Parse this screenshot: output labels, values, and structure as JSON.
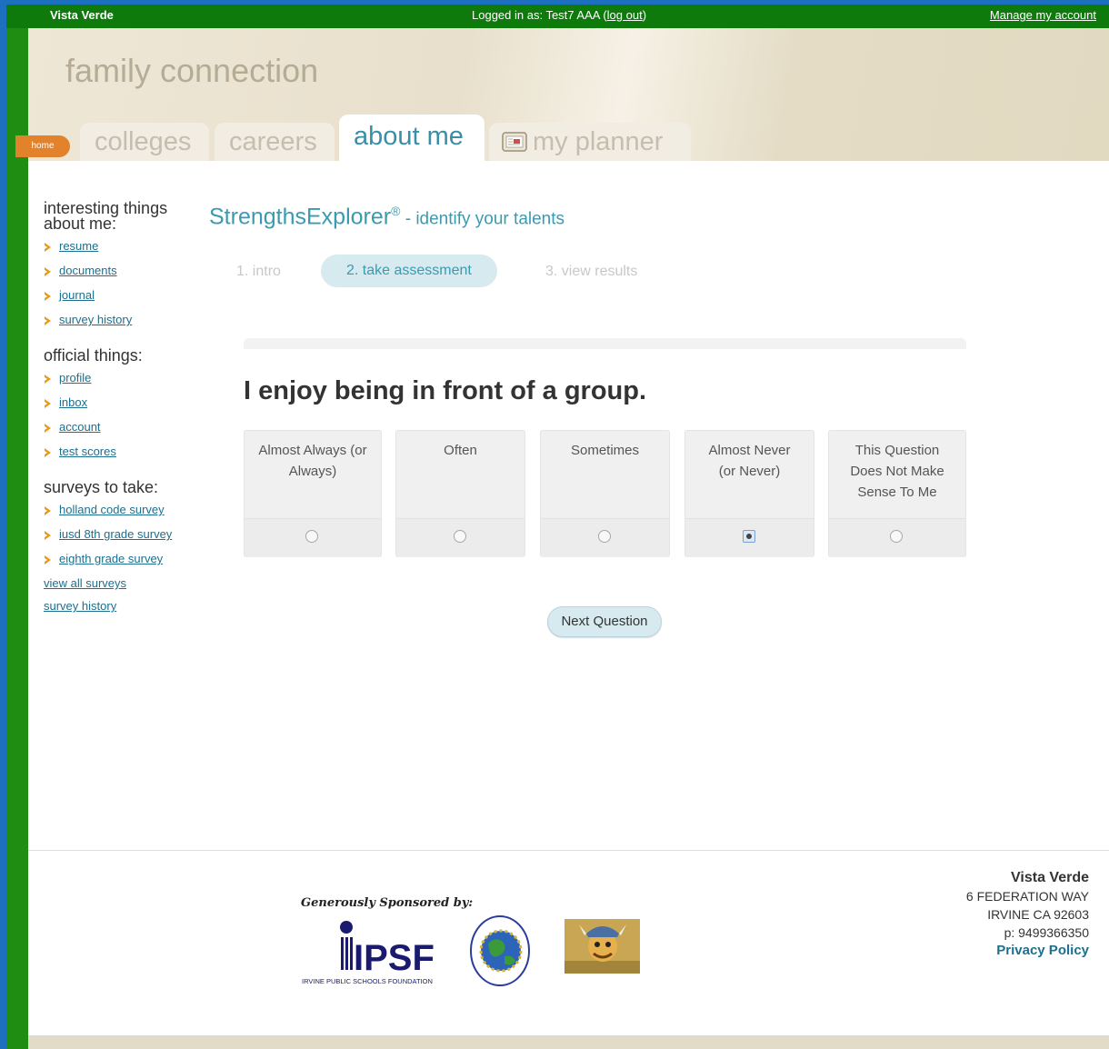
{
  "topbar": {
    "school": "Vista Verde",
    "logged_in_prefix": "Logged in as: Test7 AAA (",
    "logout_label": "log out",
    "logged_in_suffix": ")",
    "manage_account": "Manage my account"
  },
  "brand": {
    "title": "family connection"
  },
  "tabs": {
    "home": "home",
    "colleges": "colleges",
    "careers": "careers",
    "about_me": "about me",
    "my_planner": "my planner"
  },
  "sidebar": {
    "section1": {
      "heading": "interesting things about me:",
      "items": [
        "resume",
        "documents",
        "journal",
        "survey history"
      ]
    },
    "section2": {
      "heading": "official things:",
      "items": [
        "profile",
        "inbox",
        "account",
        "test scores"
      ]
    },
    "section3": {
      "heading": "surveys to take:",
      "items": [
        "holland code survey",
        "iusd 8th grade survey",
        "eighth grade survey"
      ],
      "links": [
        "view all surveys",
        "survey history"
      ]
    }
  },
  "main": {
    "title": "StrengthsExplorer",
    "registered": "®",
    "subtitle": " - identify your talents",
    "steps": [
      "1. intro",
      "2. take assessment",
      "3. view results"
    ],
    "active_step": 1,
    "question": "I enjoy being in front of a group.",
    "options": [
      {
        "label": "Almost Always (or Always)",
        "checked": false
      },
      {
        "label": "Often",
        "checked": false
      },
      {
        "label": "Sometimes",
        "checked": false
      },
      {
        "label": "Almost Never (or Never)",
        "checked": true
      },
      {
        "label": "This Question Does Not Make Sense To Me",
        "checked": false
      }
    ],
    "next_button": "Next Question"
  },
  "footer": {
    "sponsored_by": "Generously Sponsored by:",
    "ipsf_logo_text": "IPSF",
    "ipsf_caption": "IRVINE PUBLIC SCHOOLS FOUNDATION",
    "school_name": "Vista Verde",
    "address1": "6 FEDERATION WAY",
    "address2": "IRVINE CA 92603",
    "phone": "p: 9499366350",
    "privacy": "Privacy Policy"
  },
  "colors": {
    "outer_green": "#1f8c12",
    "topbar_green": "#0f7a0c",
    "accent_teal": "#3a9bb0",
    "home_orange": "#e2822b"
  }
}
